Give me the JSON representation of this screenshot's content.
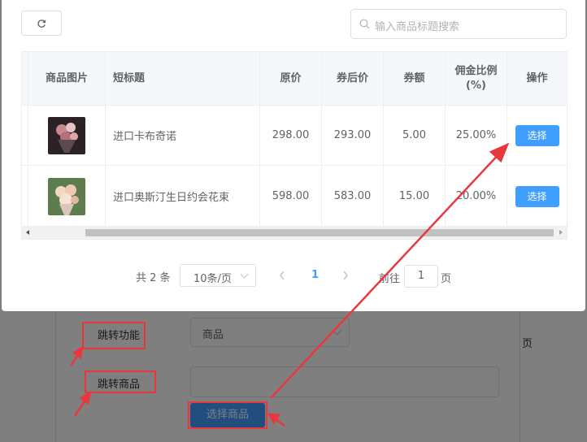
{
  "background_form": {
    "jump_function_label": "跳转功能",
    "jump_function_value": "商品",
    "jump_product_label": "跳转商品",
    "choose_product_button": "选择商品",
    "side_text": "页"
  },
  "dialog": {
    "search": {
      "placeholder": "输入商品标题搜索",
      "value": ""
    },
    "table": {
      "columns": [
        "商品图片",
        "短标题",
        "原价",
        "券后价",
        "券额",
        "佣金比例\n(%)",
        "操作"
      ],
      "rows": [
        {
          "title": "进口卡布奇诺",
          "original_price": "298.00",
          "coupon_price": "293.00",
          "coupon_amount": "5.00",
          "commission": "25.00%",
          "action": "选择",
          "thumb_color": "#3a2a2e"
        },
        {
          "title": "进口奥斯汀生日约会花束",
          "original_price": "598.00",
          "coupon_price": "583.00",
          "coupon_amount": "15.00",
          "commission": "20.00%",
          "action": "选择",
          "thumb_color": "#e9d6c4"
        }
      ]
    },
    "pagination": {
      "total": "共 2 条",
      "page_size": "10条/页",
      "current_page": "1",
      "goto_prefix": "前往",
      "goto_value": "1",
      "goto_suffix": "页"
    }
  },
  "colors": {
    "primary": "#409eff",
    "annotation": "#e8383d"
  },
  "icons": [
    "refresh-icon",
    "search-icon",
    "chevron-down-icon",
    "chevron-left-icon",
    "chevron-right-icon"
  ]
}
